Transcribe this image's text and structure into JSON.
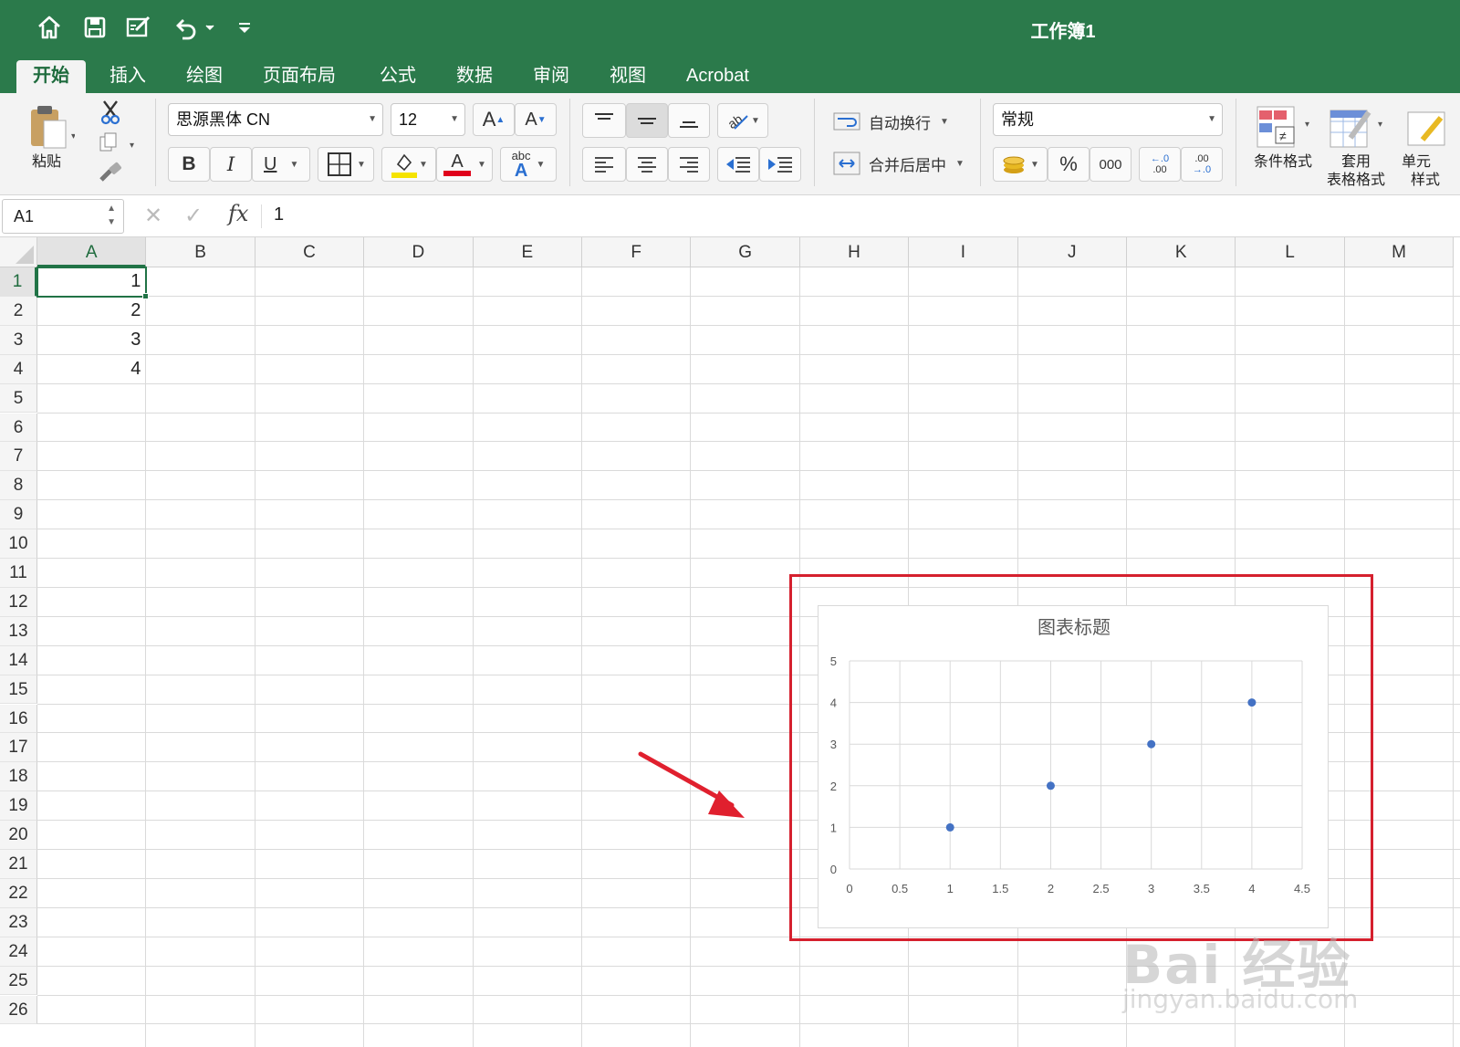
{
  "window": {
    "title": "工作簿1"
  },
  "quick_access": [
    "home-icon",
    "save-icon",
    "edit-icon",
    "undo-icon",
    "customize-icon"
  ],
  "tabs": [
    {
      "label": "开始",
      "active": true
    },
    {
      "label": "插入"
    },
    {
      "label": "绘图"
    },
    {
      "label": "页面布局"
    },
    {
      "label": "公式"
    },
    {
      "label": "数据"
    },
    {
      "label": "审阅"
    },
    {
      "label": "视图"
    },
    {
      "label": "Acrobat"
    }
  ],
  "ribbon": {
    "paste_label": "粘贴",
    "font_name": "思源黑体 CN",
    "font_size": "12",
    "grow_font": "A",
    "shrink_font": "A",
    "bold": "B",
    "italic": "I",
    "underline": "U",
    "font_color_glyph": "A",
    "phonetic_top": "abc",
    "phonetic_bottom": "A",
    "wrap_text": "自动换行",
    "merge_center": "合并后居中",
    "number_format": "常规",
    "percent": "%",
    "comma": "000",
    "inc_decimal_top": "←.0",
    "inc_decimal_bottom": ".00",
    "dec_decimal_top": ".00",
    "dec_decimal_bottom": "→.0",
    "conditional_format": "条件格式",
    "table_format_line1": "套用",
    "table_format_line2": "表格格式",
    "cell_styles_line1": "单元",
    "cell_styles_line2": "样式",
    "accent_fill": "#f5e300",
    "accent_font": "#e0001b"
  },
  "formula_bar": {
    "name_box": "A1",
    "fx": "fx",
    "value": "1"
  },
  "columns": [
    "A",
    "B",
    "C",
    "D",
    "E",
    "F",
    "G",
    "H",
    "I",
    "J",
    "K",
    "L",
    "M"
  ],
  "rows": [
    "1",
    "2",
    "3",
    "4",
    "5",
    "6",
    "7",
    "8",
    "9",
    "10",
    "11",
    "12",
    "13",
    "14",
    "15",
    "16",
    "17",
    "18",
    "19",
    "20",
    "21",
    "22",
    "23",
    "24",
    "25",
    "26"
  ],
  "cells": {
    "A1": "1",
    "A2": "2",
    "A3": "3",
    "A4": "4"
  },
  "selected_cell": "A1",
  "chart_data": {
    "type": "scatter",
    "title": "图表标题",
    "x": [
      1,
      2,
      3,
      4
    ],
    "y": [
      1,
      2,
      3,
      4
    ],
    "xlim": [
      0,
      4.5
    ],
    "ylim": [
      0,
      5
    ],
    "x_ticks": [
      "0",
      "0.5",
      "1",
      "1.5",
      "2",
      "2.5",
      "3",
      "3.5",
      "4",
      "4.5"
    ],
    "y_ticks": [
      "0",
      "1",
      "2",
      "3",
      "4",
      "5"
    ],
    "grid": true,
    "marker_color": "#4472c4"
  },
  "annotation": {
    "highlight_color": "#d5202e",
    "arrow_color": "#e0202e"
  },
  "watermark": {
    "line1": "Bai 经验",
    "line2": "jingyan.baidu.com"
  }
}
